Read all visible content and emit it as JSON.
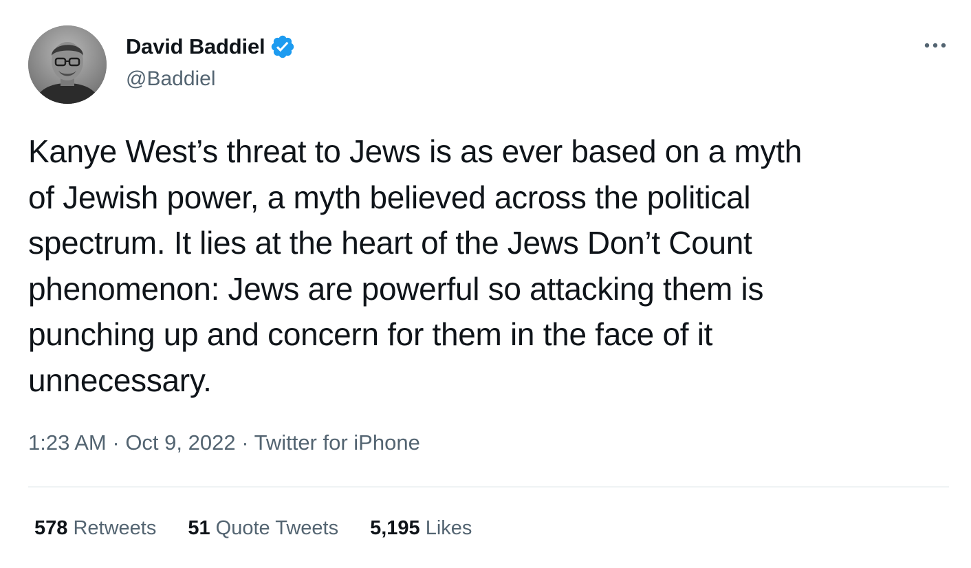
{
  "author": {
    "display_name": "David Baddiel",
    "handle": "@Baddiel",
    "verified": true,
    "avatar_icon": "profile-photo",
    "verified_color": "#1d9bf0"
  },
  "more_icon": "more-options-icon",
  "tweet": {
    "lines": [
      "Kanye West’s threat to Jews is as ever based on a myth",
      "of Jewish power, a myth believed across the political",
      "spectrum. It lies at the heart of the Jews Don’t Count",
      "phenomenon: Jews are powerful so attacking them is",
      "punching up and concern for them in the face of it",
      "unnecessary."
    ]
  },
  "meta": {
    "time": "1:23 AM",
    "sep1": " · ",
    "date": "Oct 9, 2022",
    "sep2": " · ",
    "source": "Twitter for iPhone"
  },
  "stats": {
    "retweets_count": "578",
    "retweets_label": "Retweets",
    "quotes_count": "51",
    "quotes_label": "Quote Tweets",
    "likes_count": "5,195",
    "likes_label": "Likes"
  }
}
